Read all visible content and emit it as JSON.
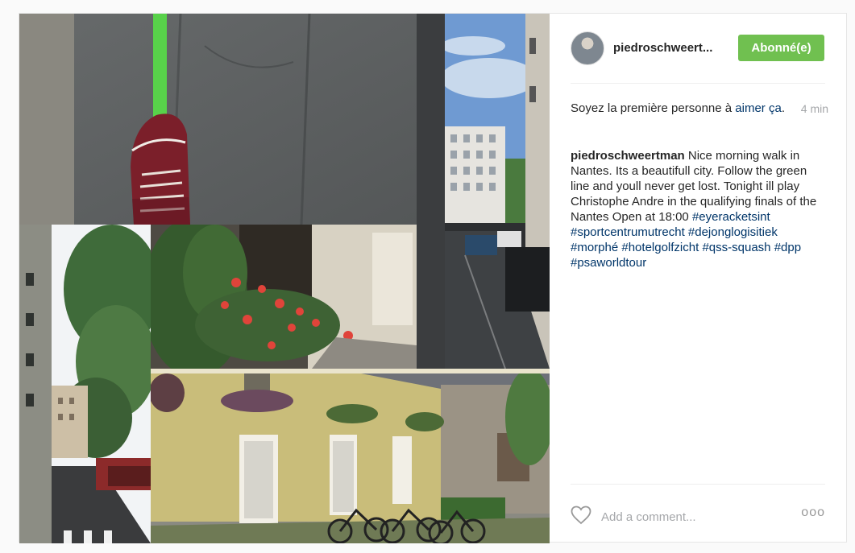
{
  "post": {
    "username": "piedroschweert...",
    "follow_label": "Abonné(e)",
    "likes_prefix": "Soyez la première personne à ",
    "likes_link": "aimer ça",
    "likes_suffix": ".",
    "time": "4 min",
    "caption_author": "piedroschweertman",
    "caption_text": " Nice morning walk in Nantes. Its a beautifull city. Follow the green line and youll never get lost. Tonight ill play Christophe Andre in the qualifying finals of the Nantes Open at 18:00",
    "hashtags": [
      "#eyeracketsint",
      "#sportcentrumutrecht",
      "#dejonglogisitiek",
      "#morphé",
      "#hotelgolfzicht",
      "#qss-squash",
      "#dpp",
      "#psaworldtour"
    ],
    "comment_placeholder": "Add a comment...",
    "more_label": "ooo"
  },
  "icons": {
    "heart": "heart-icon",
    "more": "more-options-icon",
    "avatar": "avatar"
  },
  "colors": {
    "follow_button": "#70c050",
    "link": "#003569",
    "muted": "#a5a7aa"
  }
}
